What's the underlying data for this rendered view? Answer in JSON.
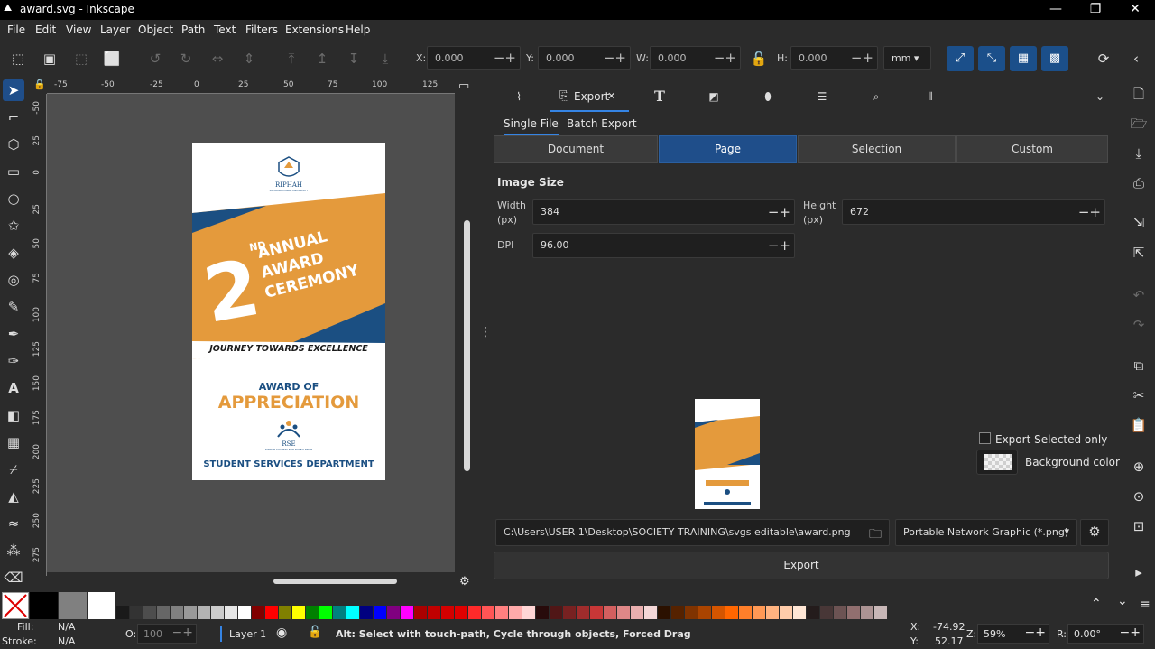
{
  "window": {
    "title": "award.svg - Inkscape",
    "minimize": "—",
    "restore": "❐",
    "close": "✕"
  },
  "menu": [
    "File",
    "Edit",
    "View",
    "Layer",
    "Object",
    "Path",
    "Text",
    "Filters",
    "Extensions",
    "Help"
  ],
  "toolbar": {
    "x_label": "X:",
    "x_value": "0.000",
    "y_label": "Y:",
    "y_value": "0.000",
    "w_label": "W:",
    "w_value": "0.000",
    "h_label": "H:",
    "h_value": "0.000",
    "unit": "mm"
  },
  "ruler_top": [
    "-75",
    "-50",
    "-25",
    "0",
    "25",
    "50",
    "75",
    "100",
    "125"
  ],
  "ruler_left": [
    "-50",
    "25",
    "0",
    "25",
    "50",
    "75",
    "100",
    "125",
    "150",
    "175",
    "200",
    "225",
    "250",
    "275"
  ],
  "artwork": {
    "logo_text": "RIPHAH",
    "logo_sub": "INTERNATIONAL UNIVERSITY",
    "ordinal": "2",
    "ordinal_suffix": "ND",
    "banner_lines": [
      "ANNUAL",
      "AWARD",
      "CEREMONY"
    ],
    "tagline": "JOURNEY TOWARDS EXCELLENCE",
    "award_of": "AWARD OF",
    "appreciation": "APPRECIATION",
    "rse": "RSE",
    "rse_sub": "RIPHAH SOCIETY FOR EXCELLENCE",
    "department": "STUDENT SERVICES DEPARTMENT",
    "colors": {
      "orange": "#e49a3c",
      "navy": "#1b4f82",
      "text_dark": "#1a1a1a"
    }
  },
  "dock_tabs": {
    "export_label": "Export",
    "close_glyph": "✕"
  },
  "export": {
    "subtabs": [
      "Single File",
      "Batch Export"
    ],
    "areas": [
      "Document",
      "Page",
      "Selection",
      "Custom"
    ],
    "selected_area": "Page",
    "image_size_title": "Image Size",
    "width_label": "Width",
    "width_unit": "(px)",
    "width_value": "384",
    "height_label": "Height",
    "height_unit": "(px)",
    "height_value": "672",
    "dpi_label": "DPI",
    "dpi_value": "96.00",
    "export_selected_only": "Export Selected only",
    "background_color": "Background color",
    "filename": "C:\\Users\\USER 1\\Desktop\\SOCIETY TRAINING\\svgs editable\\award.png",
    "format": "Portable Network Graphic (*.png)",
    "export_button": "Export"
  },
  "palette": [
    "#000000",
    "#808080",
    "#ffffff",
    "#1a1a1a",
    "#333333",
    "#4d4d4d",
    "#666666",
    "#808080",
    "#999999",
    "#b3b3b3",
    "#cccccc",
    "#e6e6e6",
    "#ffffff",
    "#800000",
    "#ff0000",
    "#808000",
    "#ffff00",
    "#008000",
    "#00ff00",
    "#008080",
    "#00ffff",
    "#000080",
    "#0000ff",
    "#800080",
    "#ff00ff",
    "#aa0000",
    "#c00000",
    "#d40000",
    "#e00000",
    "#ff2a2a",
    "#ff5555",
    "#ff8080",
    "#ffaaaa",
    "#ffd5d5",
    "#280b0b",
    "#501616",
    "#782121",
    "#a02c2c",
    "#c83737",
    "#d35f5f",
    "#de8787",
    "#e9afaf",
    "#f4d7d7",
    "#2b1100",
    "#552200",
    "#803300",
    "#aa4400",
    "#d45500",
    "#ff6600",
    "#ff7f2a",
    "#ff9955",
    "#ffb380",
    "#ffccaa",
    "#ffe6d5",
    "#241c1c",
    "#483737",
    "#6c5353",
    "#916f6f",
    "#ac9393",
    "#c8b7b7"
  ],
  "statusbar": {
    "fill_label": "Fill:",
    "fill_value": "N/A",
    "stroke_label": "Stroke:",
    "stroke_value": "N/A",
    "opacity_label": "O:",
    "opacity_value": "100",
    "layer": "Layer 1",
    "message": "Alt: Select with touch-path, Cycle through objects, Forced Drag",
    "x_label": "X:",
    "x_value": "-74.92",
    "y_label": "Y:",
    "y_value": "52.17",
    "zoom_label": "Z:",
    "zoom_value": "59%",
    "rotate_label": "R:",
    "rotate_value": "0.00°"
  }
}
